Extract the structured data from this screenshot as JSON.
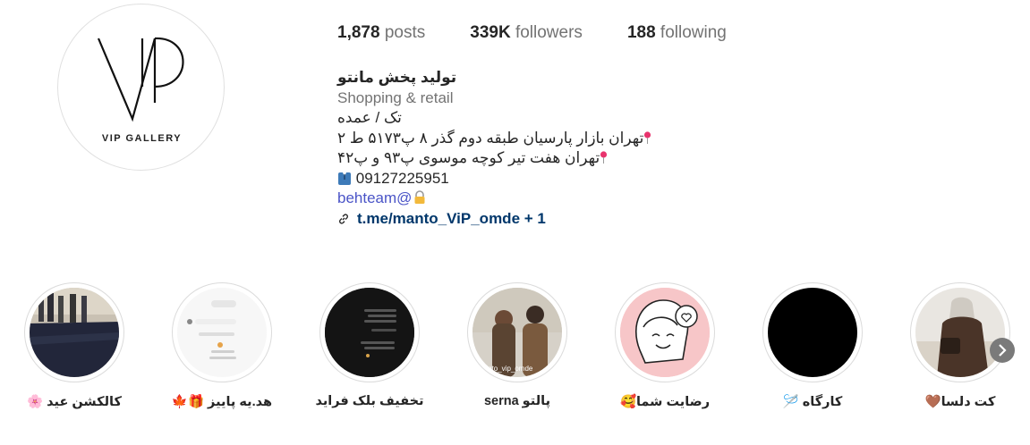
{
  "profile": {
    "logo_text": "VIP GALLERY",
    "stats": {
      "posts_count": "1,878",
      "posts_label": "posts",
      "followers_count": "339K",
      "followers_label": "followers",
      "following_count": "188",
      "following_label": "following"
    },
    "name": "تولید پخش مانتو",
    "category": "Shopping & retail",
    "bio_lines": [
      "تک / عمده",
      "تهران بازار پارسیان طبقه دوم گذر ۸ پ۵۱۷۳ ط ۲",
      "تهران هفت تیر کوچه موسوی پ۹۳ و پ۴۲",
      "09127225951",
      "behteam@"
    ],
    "link": "t.me/manto_ViP_omde + 1"
  },
  "highlights": [
    {
      "label": "کالکشن عید 🌸",
      "thumb": "fabric-rolls"
    },
    {
      "label": "هد.یه پاییز 🎁🍁",
      "thumb": "chat-screenshot-light"
    },
    {
      "label": "تخفیف بلک فراید",
      "thumb": "chat-screenshot-dark"
    },
    {
      "label": "پالتو serna",
      "thumb": "couple-photo",
      "overlay_text": "manto_vip_omde"
    },
    {
      "label": "رضایت شما🥰",
      "thumb": "smiley-heart-illustration"
    },
    {
      "label": "کارگاه 🪡",
      "thumb": "black"
    },
    {
      "label": "کت دلسا🤎",
      "thumb": "woman-coat"
    }
  ],
  "icons": {
    "next": "chevron-right-icon",
    "link": "chain-link-icon",
    "pin": "round-pushpin-icon",
    "lock": "lock-icon",
    "phone_person": "person-suit-icon"
  }
}
